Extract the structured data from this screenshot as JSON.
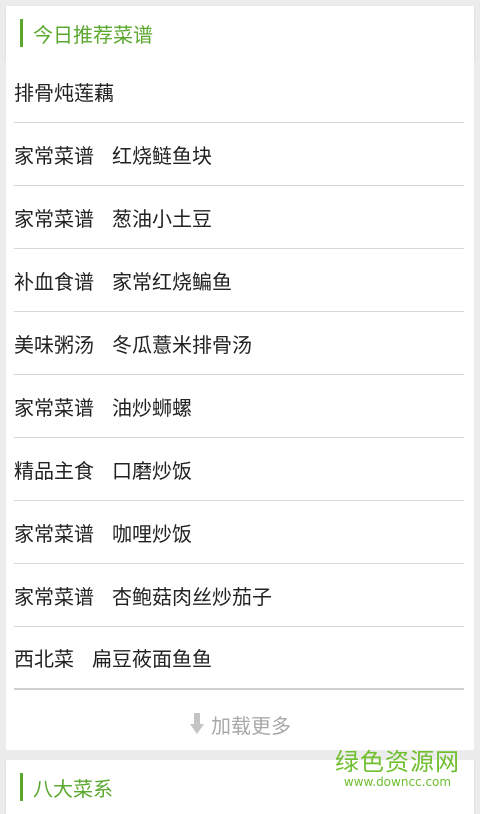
{
  "today_section": {
    "title": "今日推荐菜谱"
  },
  "recipes": [
    {
      "category": "",
      "name": "排骨炖莲藕"
    },
    {
      "category": "家常菜谱",
      "name": "红烧鲢鱼块"
    },
    {
      "category": "家常菜谱",
      "name": "葱油小土豆"
    },
    {
      "category": "补血食谱",
      "name": "家常红烧鳊鱼"
    },
    {
      "category": "美味粥汤",
      "name": "冬瓜薏米排骨汤"
    },
    {
      "category": "家常菜谱",
      "name": "油炒蛳螺"
    },
    {
      "category": "精品主食",
      "name": "口磨炒饭"
    },
    {
      "category": "家常菜谱",
      "name": "咖哩炒饭"
    },
    {
      "category": "家常菜谱",
      "name": "杏鲍菇肉丝炒茄子"
    },
    {
      "category": "西北菜",
      "name": "扁豆莜面鱼鱼"
    }
  ],
  "load_more": {
    "label": "加载更多",
    "icon": "down-arrow-icon"
  },
  "eight_section": {
    "title": "八大菜系"
  },
  "watermark": {
    "main": "绿色资源网",
    "sub": "www.downcc.com"
  },
  "colors": {
    "accent": "#5aa82e",
    "divider": "#d6d6d6",
    "muted": "#a8a8a8"
  }
}
